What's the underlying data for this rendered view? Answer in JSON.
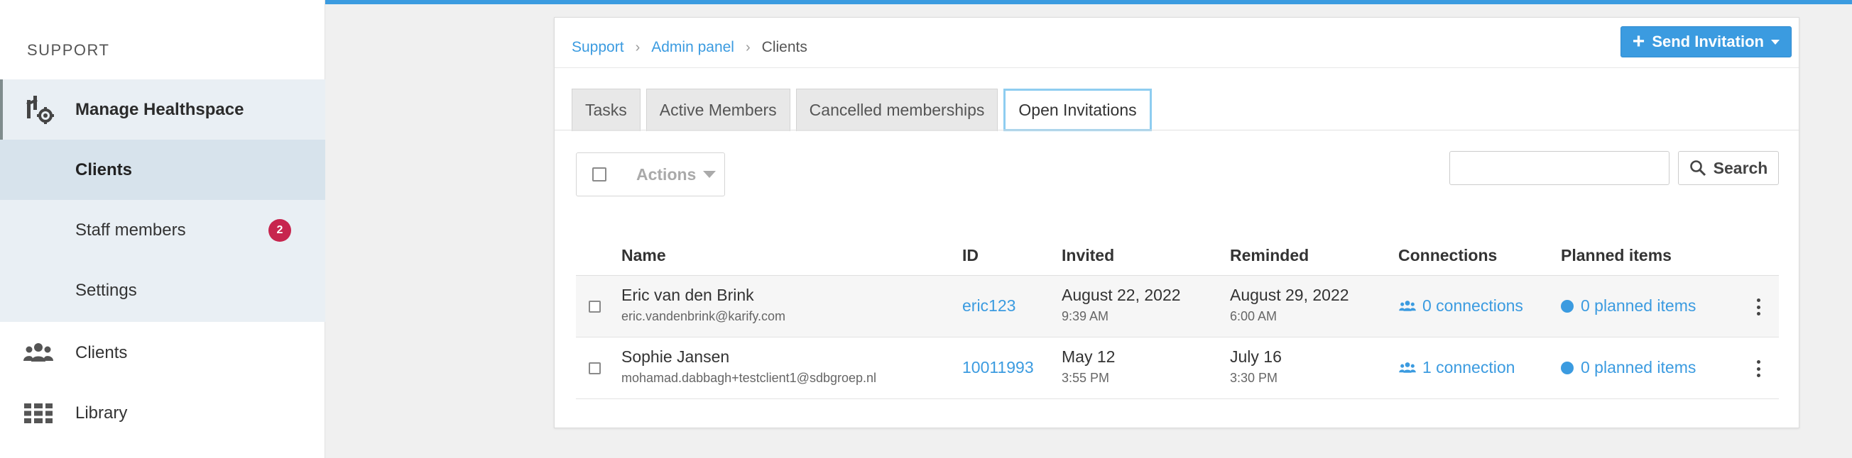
{
  "sidebar": {
    "section_title": "SUPPORT",
    "parent_item": {
      "label": "Manage Healthspace",
      "icon": "healthspace-gear-icon"
    },
    "children": [
      {
        "label": "Clients",
        "active": true
      },
      {
        "label": "Staff members",
        "badge": "2"
      },
      {
        "label": "Settings"
      }
    ],
    "items": [
      {
        "label": "Clients",
        "icon": "users-icon"
      },
      {
        "label": "Library",
        "icon": "grid-icon"
      }
    ]
  },
  "breadcrumb": {
    "items": [
      "Support",
      "Admin panel"
    ],
    "current": "Clients"
  },
  "send_invitation": {
    "label": "Send Invitation",
    "icon": "plus-icon"
  },
  "tabs": [
    {
      "label": "Tasks"
    },
    {
      "label": "Active Members"
    },
    {
      "label": "Cancelled memberships"
    },
    {
      "label": "Open Invitations",
      "active": true
    }
  ],
  "toolbar": {
    "actions_label": "Actions",
    "search_placeholder": "",
    "search_label": "Search"
  },
  "table": {
    "headers": [
      "Name",
      "ID",
      "Invited",
      "Reminded",
      "Connections",
      "Planned items"
    ],
    "rows": [
      {
        "name": "Eric van den Brink",
        "email": "eric.vandenbrink@karify.com",
        "id": "eric123",
        "invited_date": "August 22, 2022",
        "invited_time": "9:39 AM",
        "reminded_date": "August 29, 2022",
        "reminded_time": "6:00 AM",
        "connections": "0 connections",
        "planned": "0 planned items"
      },
      {
        "name": "Sophie Jansen",
        "email": "mohamad.dabbagh+testclient1@sdbgroep.nl",
        "id": "10011993",
        "invited_date": "May 12",
        "invited_time": "3:55 PM",
        "reminded_date": "July 16",
        "reminded_time": "3:30 PM",
        "connections": "1 connection",
        "planned": "0 planned items"
      }
    ]
  },
  "colors": {
    "accent": "#3b9be0",
    "badge": "#c7254e",
    "sidebar_group": "#e9eff4",
    "sidebar_active": "#d7e3ec"
  }
}
